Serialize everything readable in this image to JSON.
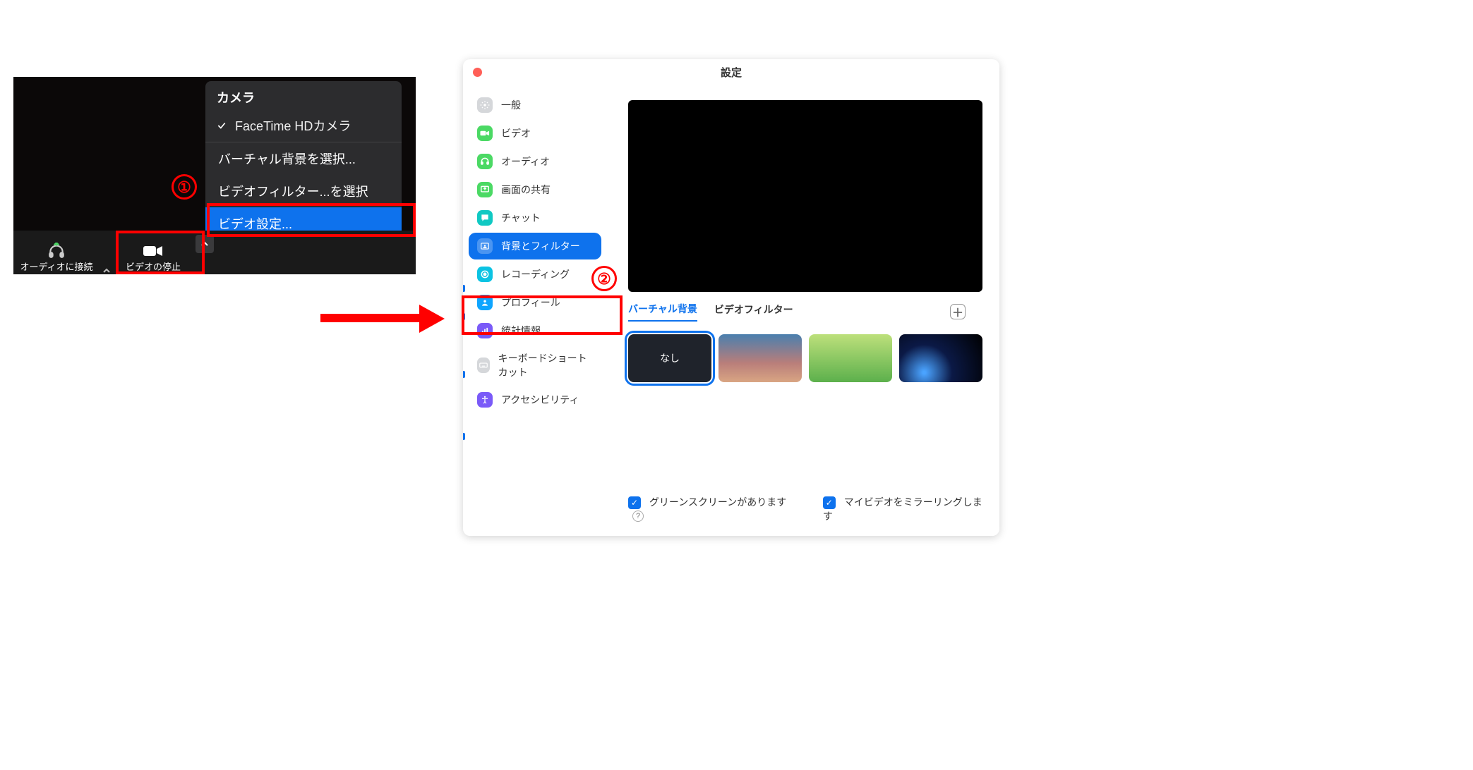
{
  "annotations": {
    "step1": "①",
    "step2": "②"
  },
  "left": {
    "popup_title": "カメラ",
    "camera_option": "FaceTime HDカメラ",
    "camera_checked": true,
    "action_vb": "バーチャル背景を選択...",
    "action_vf": "ビデオフィルター...を選択",
    "action_vs": "ビデオ設定...",
    "toolbar_audio": "オーディオに接続",
    "toolbar_video": "ビデオの停止"
  },
  "settings": {
    "window_title": "設定",
    "sidebar": {
      "general": "一般",
      "video": "ビデオ",
      "audio": "オーディオ",
      "share": "画面の共有",
      "chat": "チャット",
      "bg_filter": "背景とフィルター",
      "recording": "レコーディング",
      "profile": "プロフィール",
      "stats": "統計情報",
      "keyboard": "キーボードショートカット",
      "accessibility": "アクセシビリティ"
    },
    "tabs": {
      "virtual_bg": "バーチャル背景",
      "video_filter": "ビデオフィルター"
    },
    "bg_none": "なし",
    "checkbox_green": "グリーンスクリーンがあります",
    "checkbox_mirror": "マイビデオをミラーリングします"
  }
}
